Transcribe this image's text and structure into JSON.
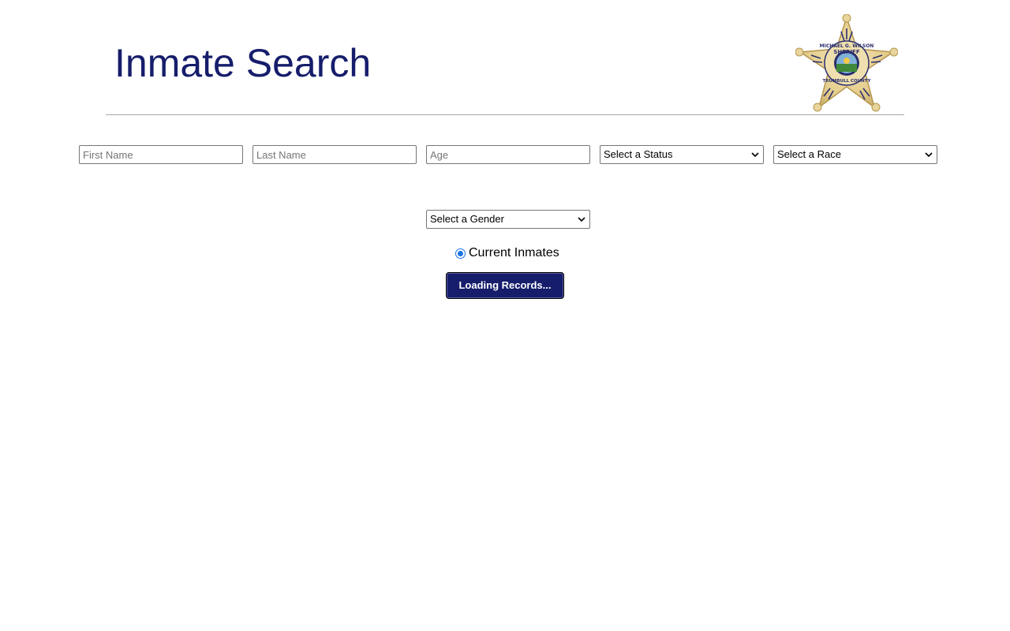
{
  "header": {
    "title": "Inmate Search",
    "badge_icon": "sheriff-star-badge-icon",
    "badge_text": {
      "top": "MICHAEL G. WILSON",
      "middle": "SHERIFF",
      "bottom": "TRUMBULL COUNTY"
    }
  },
  "search": {
    "first_name": {
      "value": "",
      "placeholder": "First Name"
    },
    "last_name": {
      "value": "",
      "placeholder": "Last Name"
    },
    "age": {
      "value": "",
      "placeholder": "Age"
    },
    "status": {
      "selected": "Select a Status"
    },
    "race": {
      "selected": "Select a Race"
    },
    "gender": {
      "selected": "Select a Gender"
    },
    "current_inmates": {
      "label": "Current Inmates",
      "checked": true
    },
    "submit_label": "Loading Records..."
  },
  "colors": {
    "title": "#161d6b",
    "button_bg": "#161d6b",
    "button_text": "#ffffff",
    "radio_accent": "#1a73e8",
    "divider": "#a9a9a9"
  }
}
